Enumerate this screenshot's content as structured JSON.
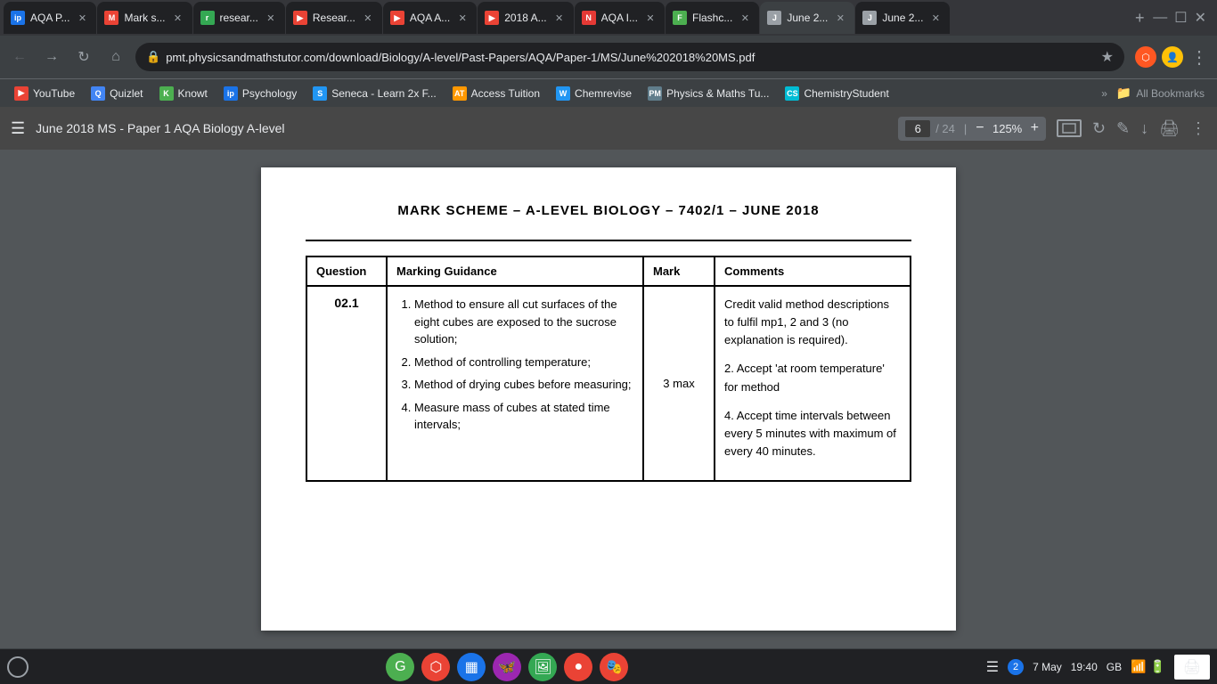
{
  "tabs": [
    {
      "id": "tab1",
      "favicon_color": "#1a73e8",
      "favicon_text": "ip",
      "title": "AQA P...",
      "active": false
    },
    {
      "id": "tab2",
      "favicon_color": "#ea4335",
      "favicon_text": "M",
      "title": "Mark s...",
      "active": false
    },
    {
      "id": "tab3",
      "favicon_color": "#34a853",
      "favicon_text": "r",
      "title": "resear...",
      "active": false
    },
    {
      "id": "tab4",
      "favicon_color": "#ea4335",
      "favicon_text": "▶",
      "title": "Resear...",
      "active": false
    },
    {
      "id": "tab5",
      "favicon_color": "#ea4335",
      "favicon_text": "▶",
      "title": "AQA A...",
      "active": false
    },
    {
      "id": "tab6",
      "favicon_color": "#ea4335",
      "favicon_text": "▶",
      "title": "2018 A...",
      "active": false
    },
    {
      "id": "tab7",
      "favicon_color": "#e53935",
      "favicon_text": "N",
      "title": "AQA I...",
      "active": false
    },
    {
      "id": "tab8",
      "favicon_color": "#4caf50",
      "favicon_text": "F",
      "title": "Flashc...",
      "active": false
    },
    {
      "id": "tab9",
      "favicon_color": "#9aa0a6",
      "favicon_text": "J",
      "title": "June 2...",
      "active": true
    },
    {
      "id": "tab10",
      "favicon_color": "#9aa0a6",
      "favicon_text": "J",
      "title": "June 2...",
      "active": false
    }
  ],
  "url": "pmt.physicsandmathstutor.com/download/Biology/A-level/Past-Papers/AQA/Paper-1/MS/June%202018%20MS.pdf",
  "bookmarks": [
    {
      "id": "bm1",
      "favicon_color": "#ea4335",
      "favicon_text": "▶",
      "label": "YouTube"
    },
    {
      "id": "bm2",
      "favicon_color": "#4285f4",
      "favicon_text": "Q",
      "label": "Quizlet"
    },
    {
      "id": "bm3",
      "favicon_color": "#4caf50",
      "favicon_text": "K",
      "label": "Knowt"
    },
    {
      "id": "bm4",
      "favicon_color": "#1a73e8",
      "favicon_text": "ip",
      "label": "Psychology"
    },
    {
      "id": "bm5",
      "favicon_color": "#2196f3",
      "favicon_text": "S",
      "label": "Seneca - Learn 2x F..."
    },
    {
      "id": "bm6",
      "favicon_color": "#ff9800",
      "favicon_text": "AT",
      "label": "Access Tuition"
    },
    {
      "id": "bm7",
      "favicon_color": "#2196f3",
      "favicon_text": "W",
      "label": "Chemrevise"
    },
    {
      "id": "bm8",
      "favicon_color": "#607d8b",
      "favicon_text": "PM",
      "label": "Physics & Maths Tu..."
    },
    {
      "id": "bm9",
      "favicon_color": "#00bcd4",
      "favicon_text": "CS",
      "label": "ChemistryStudent"
    }
  ],
  "bookmarks_more": "»",
  "all_bookmarks_label": "All Bookmarks",
  "pdf": {
    "toolbar": {
      "menu_icon": "☰",
      "title": "June 2018 MS - Paper 1 AQA Biology A-level",
      "current_page": "6",
      "total_pages": "24",
      "zoom": "125%",
      "edit_icon": "✏",
      "download_icon": "⬇",
      "print_icon": "🖨",
      "more_icon": "⋮"
    },
    "header": "MARK SCHEME – A-LEVEL BIOLOGY – 7402/1 – JUNE 2018",
    "table": {
      "headers": [
        "Question",
        "Marking Guidance",
        "Mark",
        "Comments"
      ],
      "row": {
        "question_number": "02.1",
        "guidance_items": [
          "Method to ensure all cut surfaces of the eight cubes are exposed to the sucrose solution;",
          "Method of controlling temperature;",
          "Method of drying cubes before measuring;",
          "Measure mass of cubes at stated time intervals;"
        ],
        "mark": "3 max",
        "comments": "Credit valid method descriptions to fulfil mp1, 2 and 3 (no explanation is required).\n\n2. Accept 'at room temperature' for method\n\n4. Accept time intervals between every 5 minutes with maximum of every 40 minutes."
      }
    }
  },
  "taskbar": {
    "icons": [
      {
        "id": "ti1",
        "color": "#4caf50",
        "symbol": "G"
      },
      {
        "id": "ti2",
        "color": "#ea4335",
        "symbol": "⬡"
      },
      {
        "id": "ti3",
        "color": "#1a73e8",
        "symbol": "▦"
      },
      {
        "id": "ti4",
        "color": "#9c27b0",
        "symbol": "🦋"
      },
      {
        "id": "ti5",
        "color": "#34a853",
        "symbol": "🖼"
      },
      {
        "id": "ti6",
        "color": "#ea4335",
        "symbol": "●"
      },
      {
        "id": "ti7",
        "color": "#ea4335",
        "symbol": "🎭"
      }
    ],
    "badge_count": "2",
    "date": "7 May",
    "time": "19:40",
    "locale": "GB"
  }
}
